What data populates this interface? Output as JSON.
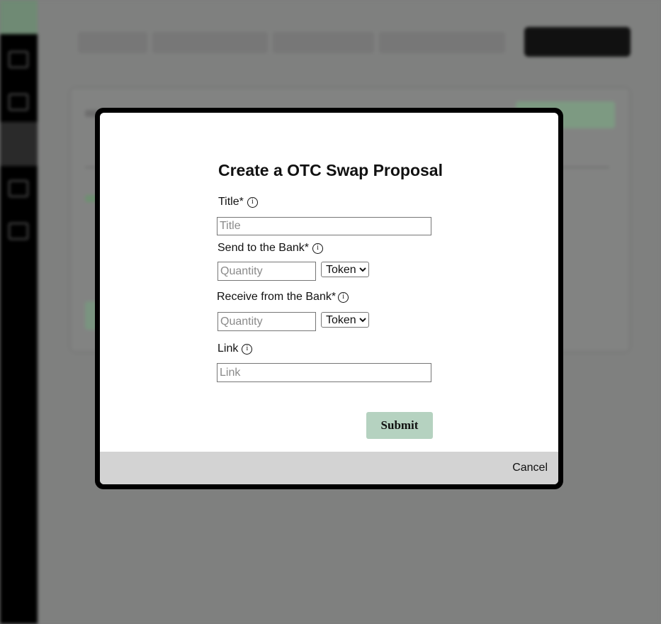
{
  "modal": {
    "title": "Create a OTC Swap Proposal",
    "fields": {
      "title_label": "Title*",
      "title_placeholder": "Title",
      "send_label": "Send to the Bank*",
      "send_quantity_placeholder": "Quantity",
      "send_token_selected": "Token",
      "receive_label": "Receive from the Bank*",
      "receive_quantity_placeholder": "Quantity",
      "receive_token_selected": "Token",
      "link_label": "Link",
      "link_placeholder": "Link"
    },
    "info_glyph": "i",
    "submit_label": "Submit",
    "cancel_label": "Cancel"
  },
  "colors": {
    "submit_bg": "#b5d2c0",
    "footer_bg": "#d3d3d3",
    "overlay": "#7c7d7c"
  },
  "icons": [
    "info-icon",
    "chevron-down-icon"
  ]
}
